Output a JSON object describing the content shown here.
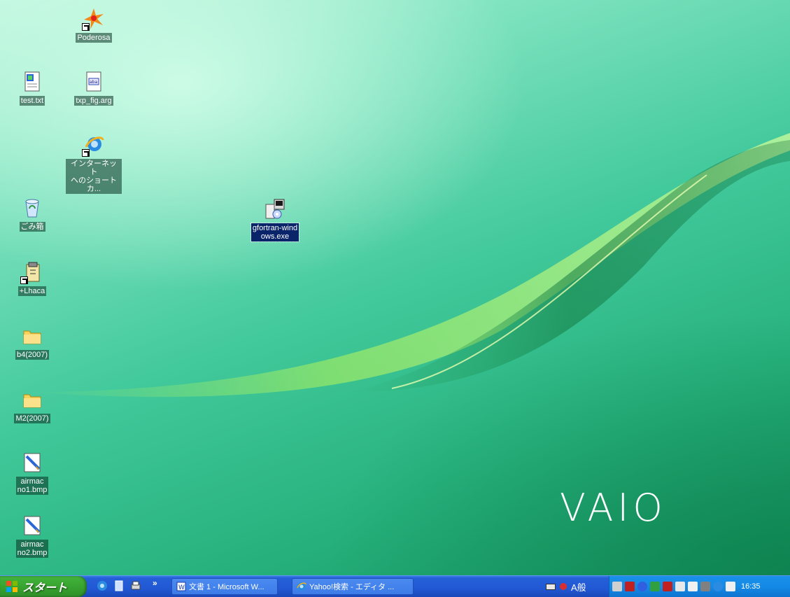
{
  "desktop": {
    "brand_logo": "VAIO",
    "icons": [
      {
        "label": "Poderosa"
      },
      {
        "label": "test.txt"
      },
      {
        "label": "txp_fig.arg"
      },
      {
        "label": "インターネット\nへのショートカ..."
      },
      {
        "label": "ごみ箱"
      },
      {
        "label": "gfortran-wind\nows.exe"
      },
      {
        "label": "+Lhaca"
      },
      {
        "label": "b4(2007)"
      },
      {
        "label": "M2(2007)"
      },
      {
        "label": "airmac\nno1.bmp"
      },
      {
        "label": "airmac\nno2.bmp"
      }
    ]
  },
  "taskbar": {
    "start_label": "スタート",
    "overflow_label": "»",
    "tasks": [
      {
        "label": "文書 1 - Microsoft W..."
      },
      {
        "label": "Yahoo!検索 - エディタ ..."
      }
    ],
    "ime_label": "A般",
    "clock": "16:35"
  },
  "colors": {
    "taskbar_blue": "#2158d4",
    "start_green": "#3aa832",
    "tray_blue": "#148ae6",
    "selection_blue": "#0a246a"
  }
}
